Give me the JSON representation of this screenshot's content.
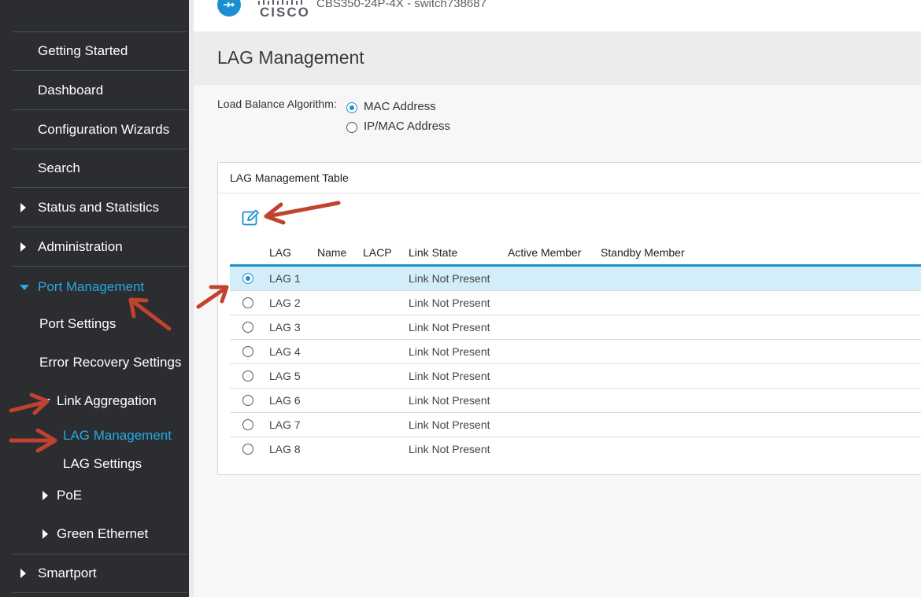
{
  "header": {
    "brand": "CISCO",
    "device": "CBS350-24P-4X - switch738687"
  },
  "sidebar": {
    "items": [
      {
        "label": "Getting Started"
      },
      {
        "label": "Dashboard"
      },
      {
        "label": "Configuration Wizards"
      },
      {
        "label": "Search"
      },
      {
        "label": "Status and Statistics"
      },
      {
        "label": "Administration"
      },
      {
        "label": "Port Management"
      },
      {
        "label": "Port Settings"
      },
      {
        "label": "Error Recovery Settings"
      },
      {
        "label": "Link Aggregation"
      },
      {
        "label": "LAG Management"
      },
      {
        "label": "LAG Settings"
      },
      {
        "label": "PoE"
      },
      {
        "label": "Green Ethernet"
      },
      {
        "label": "Smartport"
      }
    ]
  },
  "page": {
    "title": "LAG Management",
    "lba_label": "Load Balance Algorithm:",
    "lba_options": [
      "MAC Address",
      "IP/MAC Address"
    ],
    "lba_selected": "MAC Address"
  },
  "table": {
    "title": "LAG Management Table",
    "columns": [
      "LAG",
      "Name",
      "LACP",
      "Link State",
      "Active Member",
      "Standby Member"
    ],
    "rows": [
      {
        "lag": "LAG 1",
        "state": "Link Not Present"
      },
      {
        "lag": "LAG 2",
        "state": "Link Not Present"
      },
      {
        "lag": "LAG 3",
        "state": "Link Not Present"
      },
      {
        "lag": "LAG 4",
        "state": "Link Not Present"
      },
      {
        "lag": "LAG 5",
        "state": "Link Not Present"
      },
      {
        "lag": "LAG 6",
        "state": "Link Not Present"
      },
      {
        "lag": "LAG 7",
        "state": "Link Not Present"
      },
      {
        "lag": "LAG 8",
        "state": "Link Not Present"
      }
    ],
    "selected_row": "LAG 1"
  },
  "colors": {
    "accent": "#1d8fd1",
    "sidebar_bg": "#2b2d31",
    "selected_row": "#d3eef9",
    "annotation": "#c0432f"
  }
}
